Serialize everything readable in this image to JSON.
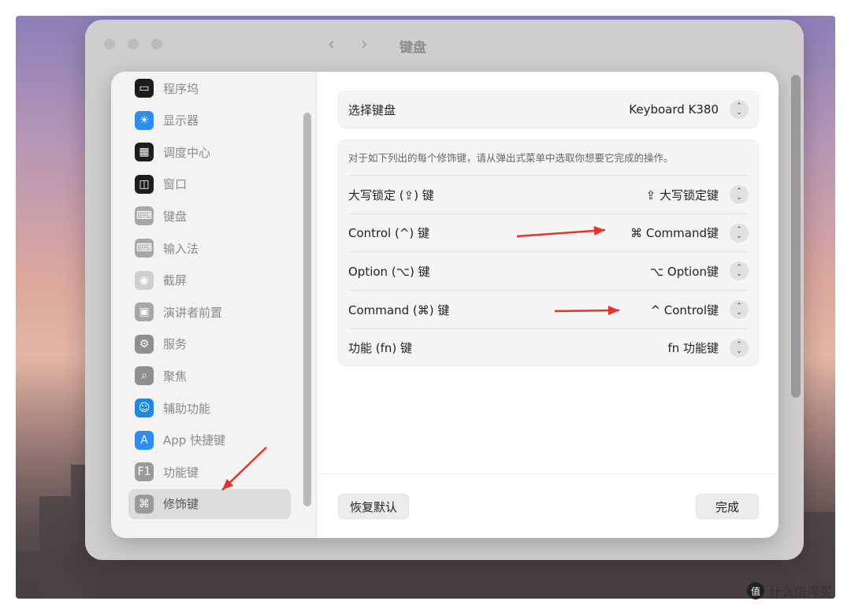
{
  "window": {
    "title": "键盘",
    "back": "‹",
    "forward": "›"
  },
  "sidebar": {
    "items": [
      {
        "label": "程序坞",
        "icon": "dock-icon",
        "color": "#1d1d1f",
        "glyph": "▭"
      },
      {
        "label": "显示器",
        "icon": "display-brightness-icon",
        "color": "#2f8cf0",
        "glyph": "☀"
      },
      {
        "label": "调度中心",
        "icon": "mission-control-icon",
        "color": "#1d1d1f",
        "glyph": "▦"
      },
      {
        "label": "窗口",
        "icon": "window-icon",
        "color": "#1d1d1f",
        "glyph": "◫"
      },
      {
        "label": "键盘",
        "icon": "keyboard-icon",
        "color": "#a7a7a7",
        "glyph": "⌨"
      },
      {
        "label": "输入法",
        "icon": "input-method-icon",
        "color": "#a7a7a7",
        "glyph": "⌨"
      },
      {
        "label": "截屏",
        "icon": "screenshot-icon",
        "color": "#cfcfcf",
        "glyph": "◉"
      },
      {
        "label": "演讲者前置",
        "icon": "presenter-overlay-icon",
        "color": "#a7a7a7",
        "glyph": "▣"
      },
      {
        "label": "服务",
        "icon": "gears-icon",
        "color": "#8f8f8f",
        "glyph": "⚙"
      },
      {
        "label": "聚焦",
        "icon": "spotlight-search-icon",
        "color": "#8f8f8f",
        "glyph": "⌕"
      },
      {
        "label": "辅助功能",
        "icon": "accessibility-icon",
        "color": "#1e88e5",
        "glyph": "☺"
      },
      {
        "label": "App 快捷键",
        "icon": "app-store-icon",
        "color": "#2f8cf0",
        "glyph": "A"
      },
      {
        "label": "功能键",
        "icon": "function-key-icon",
        "color": "#9a9a9a",
        "glyph": "F1"
      },
      {
        "label": "修饰键",
        "icon": "command-key-icon",
        "color": "#9a9a9a",
        "glyph": "⌘"
      }
    ]
  },
  "keyboard_select": {
    "label": "选择键盘",
    "value": "Keyboard K380"
  },
  "modifiers": {
    "description": "对于如下列出的每个修饰键，请从弹出式菜单中选取你想要它完成的操作。",
    "rows": [
      {
        "key": "大写锁定 (⇪) 键",
        "action": "⇪ 大写锁定键"
      },
      {
        "key": "Control (^) 键",
        "action": "⌘ Command键"
      },
      {
        "key": "Option (⌥) 键",
        "action": "⌥ Option键"
      },
      {
        "key": "Command (⌘) 键",
        "action": "^ Control键"
      },
      {
        "key": "功能 (fn) 键",
        "action": "fn 功能键"
      }
    ]
  },
  "buttons": {
    "restore_defaults": "恢复默认",
    "done": "完成"
  },
  "annotations": {
    "arrow_color": "#e8332c"
  },
  "watermark": {
    "badge": "值",
    "text": "什么值得买"
  }
}
